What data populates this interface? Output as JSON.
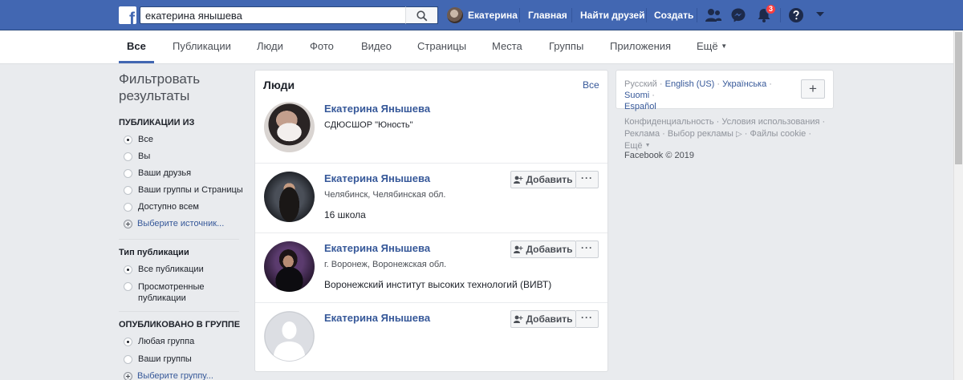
{
  "topbar": {
    "logo_letter": "f",
    "search_value": "екатерина янышева",
    "user_name": "Екатерина",
    "home_label": "Главная",
    "find_friends_label": "Найти друзей",
    "create_label": "Создать",
    "notifications_count": "3",
    "accent_color": "#4267b2"
  },
  "tabs": [
    {
      "label": "Все",
      "active": true
    },
    {
      "label": "Публикации"
    },
    {
      "label": "Люди"
    },
    {
      "label": "Фото"
    },
    {
      "label": "Видео"
    },
    {
      "label": "Страницы"
    },
    {
      "label": "Места"
    },
    {
      "label": "Группы"
    },
    {
      "label": "Приложения"
    },
    {
      "label": "Ещё"
    }
  ],
  "filters": {
    "title": "Фильтровать результаты",
    "posts_from": {
      "heading": "ПУБЛИКАЦИИ ИЗ",
      "options": [
        "Все",
        "Вы",
        "Ваши друзья",
        "Ваши группы и Страницы",
        "Доступно всем"
      ],
      "selected": "Все",
      "choose_source": "Выберите источник..."
    },
    "post_type": {
      "heading": "Тип публикации",
      "options": [
        "Все публикации",
        "Просмотренные публикации"
      ],
      "selected": "Все публикации"
    },
    "posted_in_group": {
      "heading": "ОПУБЛИКОВАНО В ГРУППЕ",
      "options": [
        "Любая группа",
        "Ваши группы"
      ],
      "selected": "Любая группа",
      "choose_group": "Выберите группу..."
    }
  },
  "people": {
    "title": "Люди",
    "see_all": "Все",
    "add_label": "Добавить",
    "results": [
      {
        "name": "Екатерина Янышева",
        "subtitle": "СДЮСШОР \"Юность\"",
        "info": "",
        "has_actions": false
      },
      {
        "name": "Екатерина Янышева",
        "subtitle": "Челябинск, Челябинская обл.",
        "info": "16 школа",
        "has_actions": true
      },
      {
        "name": "Екатерина Янышева",
        "subtitle": "г. Воронеж, Воронежская обл.",
        "info": "Воронежский институт высоких технологий (ВИВТ)",
        "has_actions": true
      },
      {
        "name": "Екатерина Янышева",
        "subtitle": "",
        "info": "",
        "has_actions": true
      }
    ]
  },
  "languages": {
    "current": "Русский",
    "others": [
      "English (US)",
      "Українська",
      "Suomi",
      "Español"
    ],
    "add_icon": "plus-icon"
  },
  "footer": {
    "links": [
      "Конфиденциальность",
      "Условия использования",
      "Реклама",
      "Выбор рекламы",
      "Файлы cookie",
      "Ещё"
    ],
    "copyright": "Facebook © 2019"
  }
}
